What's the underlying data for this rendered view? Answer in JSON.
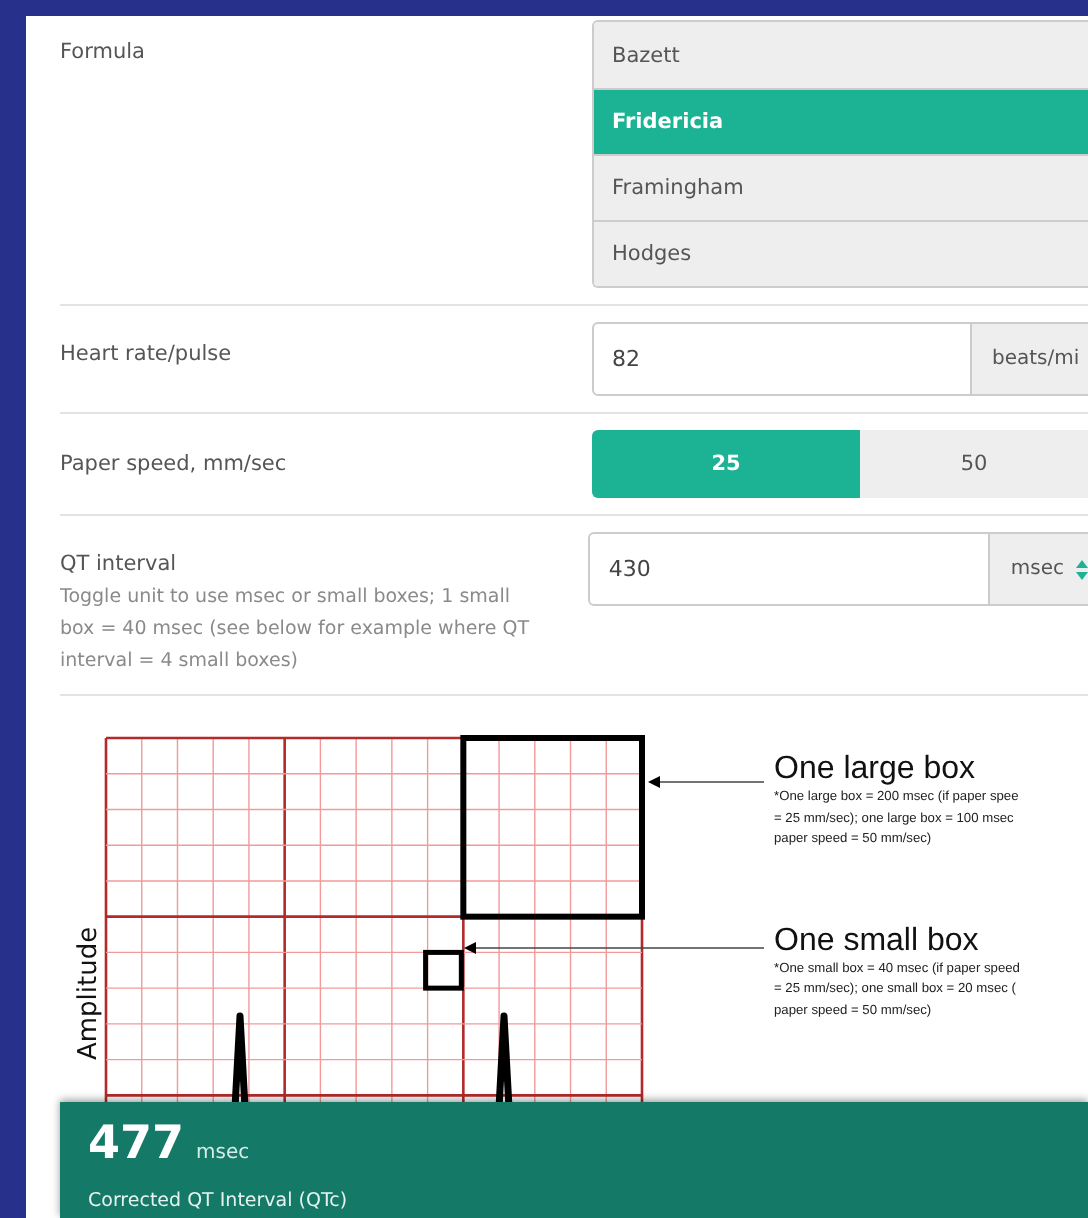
{
  "formula": {
    "label": "Formula",
    "options": [
      {
        "label": "Bazett",
        "selected": false
      },
      {
        "label": "Fridericia",
        "selected": true
      },
      {
        "label": "Framingham",
        "selected": false
      },
      {
        "label": "Hodges",
        "selected": false
      }
    ]
  },
  "heart_rate": {
    "label": "Heart rate/pulse",
    "value": "82",
    "unit": "beats/mi"
  },
  "paper_speed": {
    "label": "Paper speed, mm/sec",
    "options": [
      {
        "label": "25",
        "selected": true
      },
      {
        "label": "50",
        "selected": false
      }
    ]
  },
  "qt_interval": {
    "label": "QT interval",
    "hint": "Toggle unit to use msec or small boxes; 1 small box = 40 msec (see below for example where QT interval = 4 small boxes)",
    "value": "430",
    "unit": "msec"
  },
  "diagram": {
    "ylabel": "Amplitude",
    "callouts": [
      {
        "title": "One large box",
        "note_lines": [
          "*One large box = 200 msec (if paper spee",
          "= 25 mm/sec); one large box = 100 msec",
          "paper speed = 50 mm/sec)"
        ]
      },
      {
        "title": "One small box",
        "note_lines": [
          "*One small box = 40 msec (if paper speed",
          "= 25 mm/sec); one small box = 20 msec (",
          "paper speed = 50 mm/sec)"
        ]
      }
    ]
  },
  "result": {
    "value": "477",
    "unit": "msec",
    "label": "Corrected QT Interval (QTc)"
  }
}
